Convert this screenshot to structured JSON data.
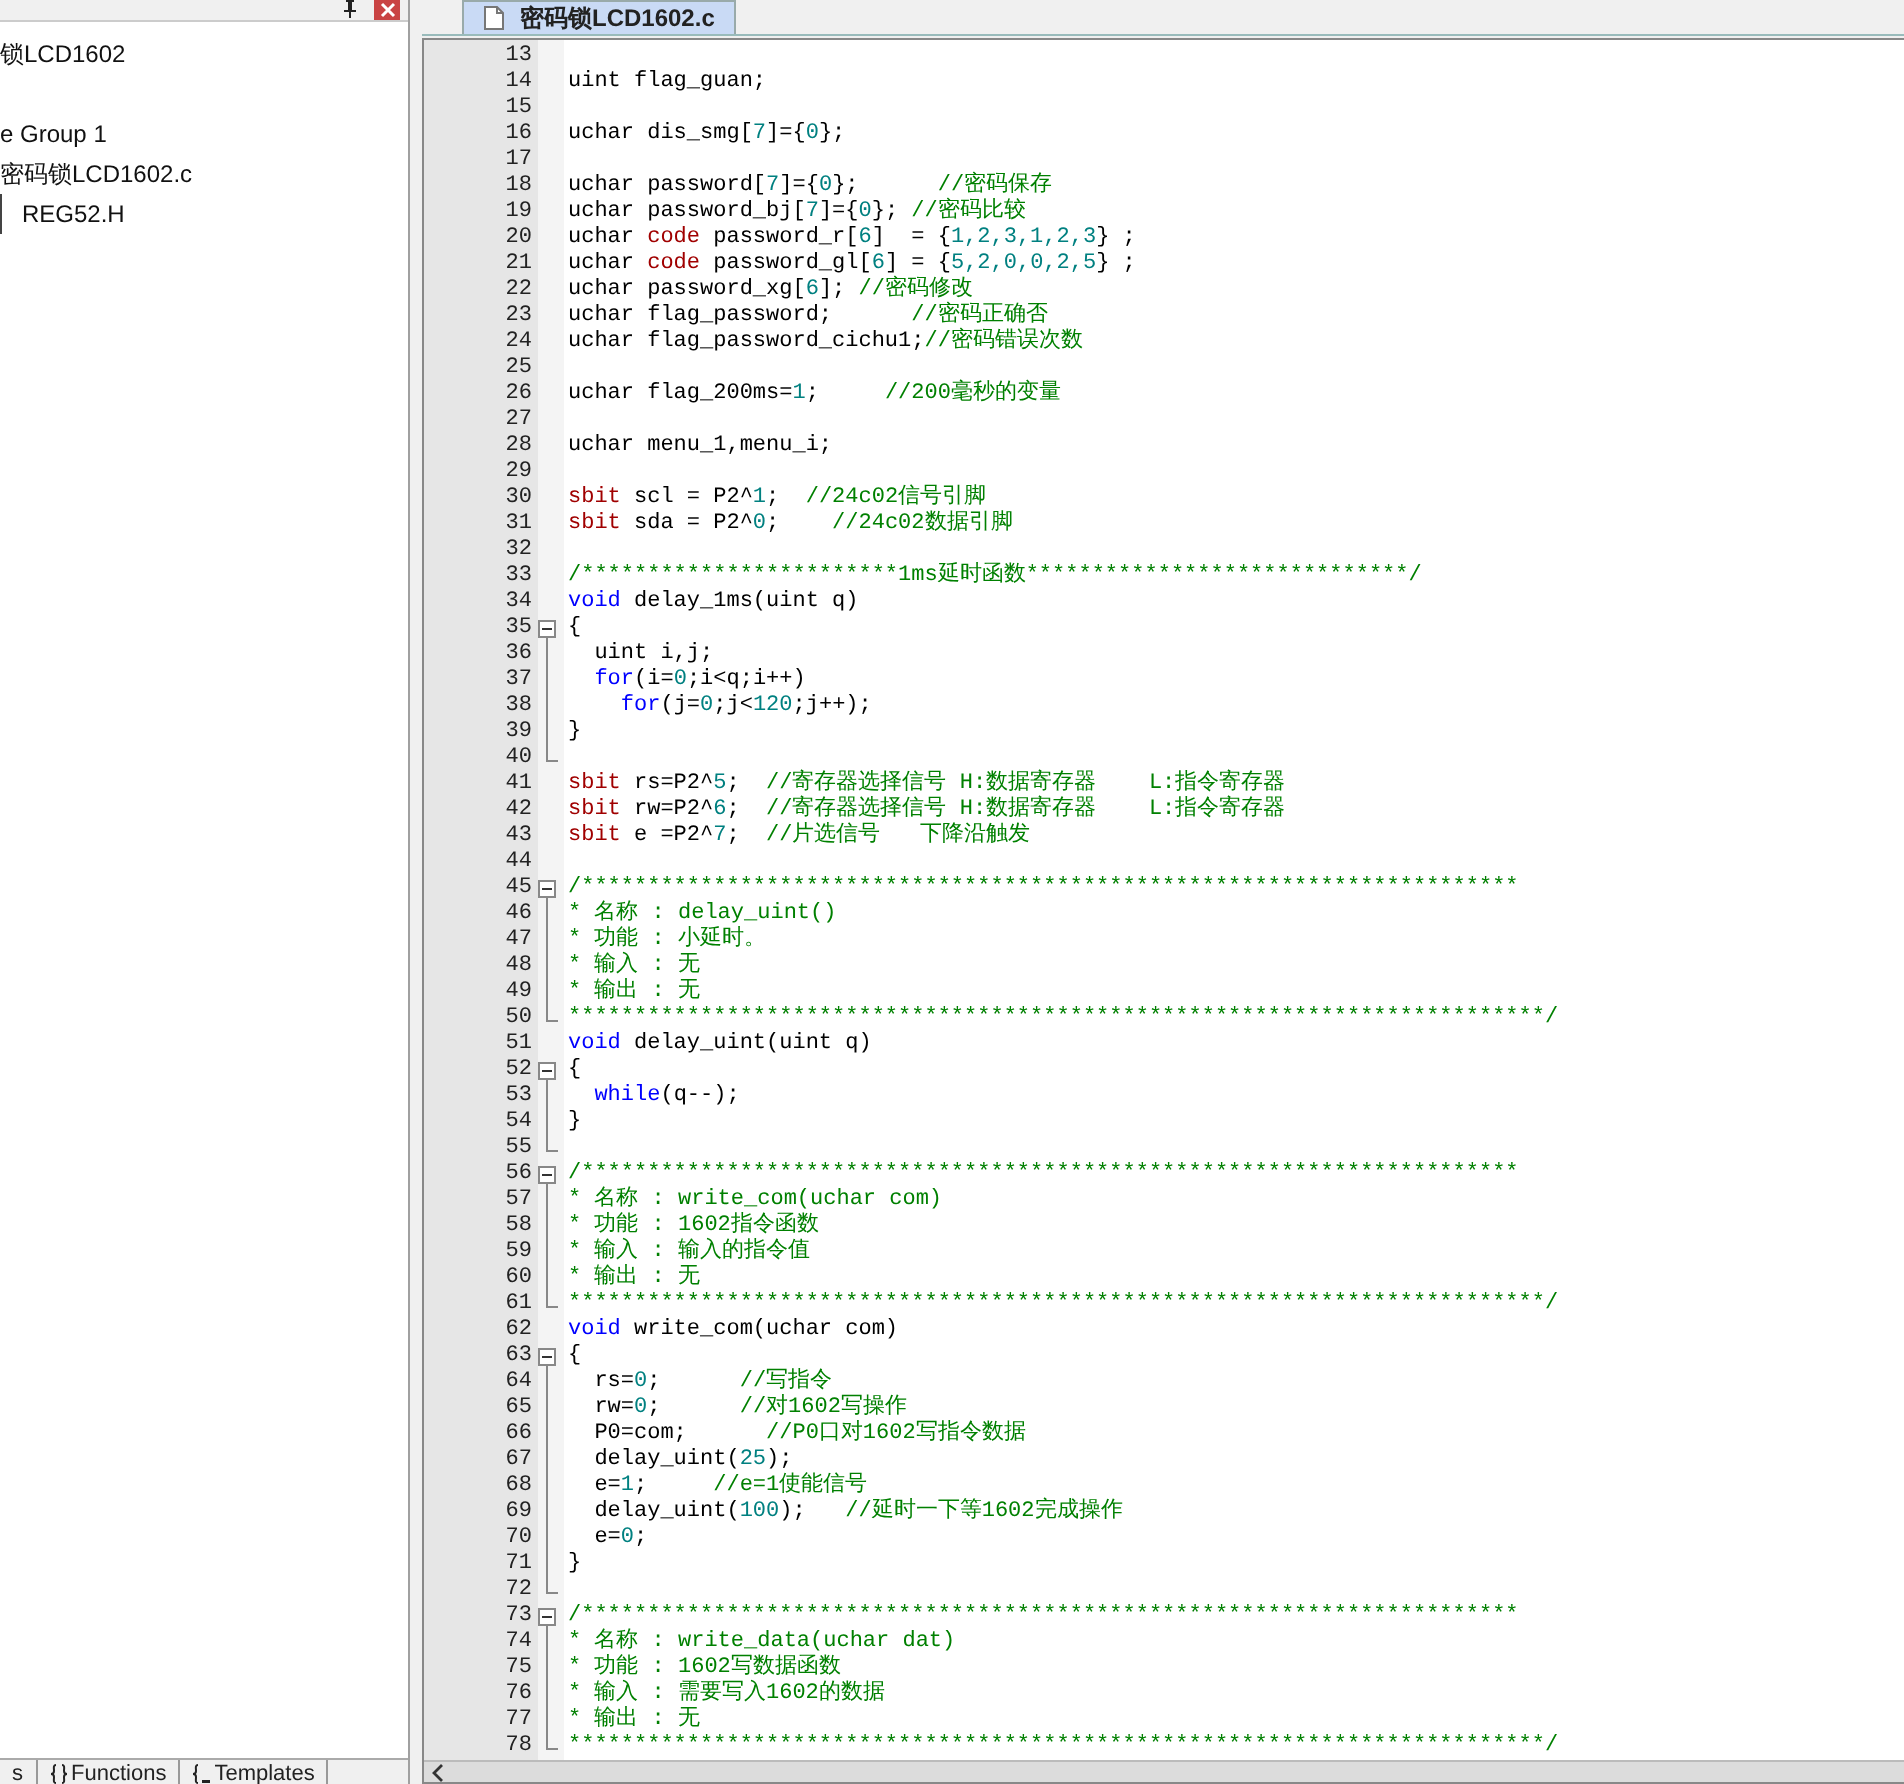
{
  "project_panel": {
    "tree": [
      {
        "label": "锁LCD1602",
        "children": [
          {
            "label": "e Group 1",
            "children": [
              {
                "label": "密码锁LCD1602.c",
                "children": [
                  {
                    "label": "REG52.H"
                  }
                ]
              }
            ]
          }
        ]
      }
    ],
    "tabs": [
      {
        "label": "s",
        "selected": false
      },
      {
        "label": "Functions",
        "selected": false
      },
      {
        "label": "Templates",
        "selected": false
      }
    ]
  },
  "editor": {
    "tabs": [
      {
        "label": "密码锁LCD1602.c",
        "selected": true
      }
    ],
    "lines": [
      {
        "number": "13",
        "kind": "code"
      },
      {
        "number": "14",
        "kind": "code",
        "segments": [
          {
            "kind": "plain",
            "text": "uint flag_guan;"
          }
        ]
      },
      {
        "number": "15",
        "kind": "code"
      },
      {
        "number": "16",
        "kind": "code",
        "segments": [
          {
            "kind": "plain",
            "text": "uchar dis_smg["
          },
          {
            "kind": "number",
            "text": "7"
          },
          {
            "kind": "plain",
            "text": "]={"
          },
          {
            "kind": "number",
            "text": "0"
          },
          {
            "kind": "plain",
            "text": "};"
          }
        ]
      },
      {
        "number": "17",
        "kind": "code"
      },
      {
        "number": "18",
        "kind": "code",
        "segments": [
          {
            "kind": "plain",
            "text": "uchar password["
          },
          {
            "kind": "number",
            "text": "7"
          },
          {
            "kind": "plain",
            "text": "]={"
          },
          {
            "kind": "number",
            "text": "0"
          },
          {
            "kind": "plain",
            "text": "};      "
          },
          {
            "kind": "comment",
            "text": "//密码保存"
          }
        ]
      },
      {
        "number": "19",
        "kind": "code",
        "segments": [
          {
            "kind": "plain",
            "text": "uchar password_bj["
          },
          {
            "kind": "number",
            "text": "7"
          },
          {
            "kind": "plain",
            "text": "]={"
          },
          {
            "kind": "number",
            "text": "0"
          },
          {
            "kind": "plain",
            "text": "}; "
          },
          {
            "kind": "comment",
            "text": "//密码比较"
          }
        ]
      },
      {
        "number": "20",
        "kind": "code",
        "segments": [
          {
            "kind": "plain",
            "text": "uchar "
          },
          {
            "kind": "storage",
            "text": "code"
          },
          {
            "kind": "plain",
            "text": " password_r["
          },
          {
            "kind": "number",
            "text": "6"
          },
          {
            "kind": "plain",
            "text": "]  = {"
          },
          {
            "kind": "number",
            "text": "1,2,3,1,2,3"
          },
          {
            "kind": "plain",
            "text": "} ;"
          }
        ]
      },
      {
        "number": "21",
        "kind": "code",
        "segments": [
          {
            "kind": "plain",
            "text": "uchar "
          },
          {
            "kind": "storage",
            "text": "code"
          },
          {
            "kind": "plain",
            "text": " password_gl["
          },
          {
            "kind": "number",
            "text": "6"
          },
          {
            "kind": "plain",
            "text": "] = {"
          },
          {
            "kind": "number",
            "text": "5,2,0,0,2,5"
          },
          {
            "kind": "plain",
            "text": "} ;"
          }
        ]
      },
      {
        "number": "22",
        "kind": "code",
        "segments": [
          {
            "kind": "plain",
            "text": "uchar password_xg["
          },
          {
            "kind": "number",
            "text": "6"
          },
          {
            "kind": "plain",
            "text": "]; "
          },
          {
            "kind": "comment",
            "text": "//密码修改"
          }
        ]
      },
      {
        "number": "23",
        "kind": "code",
        "segments": [
          {
            "kind": "plain",
            "text": "uchar flag_password;      "
          },
          {
            "kind": "comment",
            "text": "//密码正确否"
          }
        ]
      },
      {
        "number": "24",
        "kind": "code",
        "segments": [
          {
            "kind": "plain",
            "text": "uchar flag_password_cichu1;"
          },
          {
            "kind": "comment",
            "text": "//密码错误次数"
          }
        ]
      },
      {
        "number": "25",
        "kind": "code"
      },
      {
        "number": "26",
        "kind": "code",
        "segments": [
          {
            "kind": "plain",
            "text": "uchar flag_200ms="
          },
          {
            "kind": "number",
            "text": "1"
          },
          {
            "kind": "plain",
            "text": ";     "
          },
          {
            "kind": "comment",
            "text": "//200毫秒的变量"
          }
        ]
      },
      {
        "number": "27",
        "kind": "code"
      },
      {
        "number": "28",
        "kind": "code",
        "segments": [
          {
            "kind": "plain",
            "text": "uchar menu_1,menu_i;"
          }
        ]
      },
      {
        "number": "29",
        "kind": "code"
      },
      {
        "number": "30",
        "kind": "code",
        "segments": [
          {
            "kind": "storage",
            "text": "sbit"
          },
          {
            "kind": "plain",
            "text": " scl = P2^"
          },
          {
            "kind": "number",
            "text": "1"
          },
          {
            "kind": "plain",
            "text": ";  "
          },
          {
            "kind": "comment",
            "text": "//24c02信号引脚"
          }
        ]
      },
      {
        "number": "31",
        "kind": "code",
        "segments": [
          {
            "kind": "storage",
            "text": "sbit"
          },
          {
            "kind": "plain",
            "text": " sda = P2^"
          },
          {
            "kind": "number",
            "text": "0"
          },
          {
            "kind": "plain",
            "text": ";    "
          },
          {
            "kind": "comment",
            "text": "//24c02数据引脚"
          }
        ]
      },
      {
        "number": "32",
        "kind": "code"
      },
      {
        "number": "33",
        "kind": "code",
        "segments": [
          {
            "kind": "comment",
            "text": "/************************1ms延时函数*****************************/"
          }
        ]
      },
      {
        "number": "34",
        "kind": "code",
        "segments": [
          {
            "kind": "keyword",
            "text": "void"
          },
          {
            "kind": "plain",
            "text": " delay_1ms(uint q)"
          }
        ]
      },
      {
        "number": "35",
        "kind": "fold-start",
        "segments": [
          {
            "kind": "plain",
            "text": "{"
          }
        ]
      },
      {
        "number": "36",
        "kind": "fold-body",
        "segments": [
          {
            "kind": "plain",
            "text": "  uint i,j;"
          }
        ]
      },
      {
        "number": "37",
        "kind": "fold-body",
        "segments": [
          {
            "kind": "keyword",
            "text": "  for"
          },
          {
            "kind": "plain",
            "text": "(i="
          },
          {
            "kind": "number",
            "text": "0"
          },
          {
            "kind": "plain",
            "text": ";i<q;i++)"
          }
        ]
      },
      {
        "number": "38",
        "kind": "fold-body",
        "segments": [
          {
            "kind": "keyword",
            "text": "    for"
          },
          {
            "kind": "plain",
            "text": "(j="
          },
          {
            "kind": "number",
            "text": "0"
          },
          {
            "kind": "plain",
            "text": ";j<"
          },
          {
            "kind": "number",
            "text": "120"
          },
          {
            "kind": "plain",
            "text": ";j++);"
          }
        ]
      },
      {
        "number": "39",
        "kind": "fold-body",
        "segments": [
          {
            "kind": "plain",
            "text": "}"
          }
        ]
      },
      {
        "number": "40",
        "kind": "fold-end"
      },
      {
        "number": "41",
        "kind": "code",
        "segments": [
          {
            "kind": "storage",
            "text": "sbit"
          },
          {
            "kind": "plain",
            "text": " rs=P2^"
          },
          {
            "kind": "number",
            "text": "5"
          },
          {
            "kind": "plain",
            "text": ";  "
          },
          {
            "kind": "comment",
            "text": "//寄存器选择信号 H:数据寄存器    L:指令寄存器"
          }
        ]
      },
      {
        "number": "42",
        "kind": "code",
        "segments": [
          {
            "kind": "storage",
            "text": "sbit"
          },
          {
            "kind": "plain",
            "text": " rw=P2^"
          },
          {
            "kind": "number",
            "text": "6"
          },
          {
            "kind": "plain",
            "text": ";  "
          },
          {
            "kind": "comment",
            "text": "//寄存器选择信号 H:数据寄存器    L:指令寄存器"
          }
        ]
      },
      {
        "number": "43",
        "kind": "code",
        "segments": [
          {
            "kind": "storage",
            "text": "sbit"
          },
          {
            "kind": "plain",
            "text": " e =P2^"
          },
          {
            "kind": "number",
            "text": "7"
          },
          {
            "kind": "plain",
            "text": ";  "
          },
          {
            "kind": "comment",
            "text": "//片选信号   下降沿触发"
          }
        ]
      },
      {
        "number": "44",
        "kind": "code"
      },
      {
        "number": "45",
        "kind": "fold-start",
        "segments": [
          {
            "kind": "comment",
            "text": "/***********************************************************************"
          }
        ]
      },
      {
        "number": "46",
        "kind": "fold-body",
        "segments": [
          {
            "kind": "comment",
            "text": "* 名称 : delay_uint()"
          }
        ]
      },
      {
        "number": "47",
        "kind": "fold-body",
        "segments": [
          {
            "kind": "comment",
            "text": "* 功能 : 小延时。"
          }
        ]
      },
      {
        "number": "48",
        "kind": "fold-body",
        "segments": [
          {
            "kind": "comment",
            "text": "* 输入 : 无"
          }
        ]
      },
      {
        "number": "49",
        "kind": "fold-body",
        "segments": [
          {
            "kind": "comment",
            "text": "* 输出 : 无"
          }
        ]
      },
      {
        "number": "50",
        "kind": "fold-end",
        "segments": [
          {
            "kind": "comment",
            "text": "**************************************************************************/"
          }
        ]
      },
      {
        "number": "51",
        "kind": "code",
        "segments": [
          {
            "kind": "keyword",
            "text": "void"
          },
          {
            "kind": "plain",
            "text": " delay_uint(uint q)"
          }
        ]
      },
      {
        "number": "52",
        "kind": "fold-start",
        "segments": [
          {
            "kind": "plain",
            "text": "{"
          }
        ]
      },
      {
        "number": "53",
        "kind": "fold-body",
        "segments": [
          {
            "kind": "keyword",
            "text": "  while"
          },
          {
            "kind": "plain",
            "text": "(q--);"
          }
        ]
      },
      {
        "number": "54",
        "kind": "fold-body",
        "segments": [
          {
            "kind": "plain",
            "text": "}"
          }
        ]
      },
      {
        "number": "55",
        "kind": "fold-end"
      },
      {
        "number": "56",
        "kind": "fold-start",
        "segments": [
          {
            "kind": "comment",
            "text": "/***********************************************************************"
          }
        ]
      },
      {
        "number": "57",
        "kind": "fold-body",
        "segments": [
          {
            "kind": "comment",
            "text": "* 名称 : write_com(uchar com)"
          }
        ]
      },
      {
        "number": "58",
        "kind": "fold-body",
        "segments": [
          {
            "kind": "comment",
            "text": "* 功能 : 1602指令函数"
          }
        ]
      },
      {
        "number": "59",
        "kind": "fold-body",
        "segments": [
          {
            "kind": "comment",
            "text": "* 输入 : 输入的指令值"
          }
        ]
      },
      {
        "number": "60",
        "kind": "fold-body",
        "segments": [
          {
            "kind": "comment",
            "text": "* 输出 : 无"
          }
        ]
      },
      {
        "number": "61",
        "kind": "fold-end",
        "segments": [
          {
            "kind": "comment",
            "text": "**************************************************************************/"
          }
        ]
      },
      {
        "number": "62",
        "kind": "code",
        "segments": [
          {
            "kind": "keyword",
            "text": "void"
          },
          {
            "kind": "plain",
            "text": " write_com(uchar com)"
          }
        ]
      },
      {
        "number": "63",
        "kind": "fold-start",
        "segments": [
          {
            "kind": "plain",
            "text": "{"
          }
        ]
      },
      {
        "number": "64",
        "kind": "fold-body",
        "segments": [
          {
            "kind": "plain",
            "text": "  rs="
          },
          {
            "kind": "number",
            "text": "0"
          },
          {
            "kind": "plain",
            "text": ";      "
          },
          {
            "kind": "comment",
            "text": "//写指令"
          }
        ]
      },
      {
        "number": "65",
        "kind": "fold-body",
        "segments": [
          {
            "kind": "plain",
            "text": "  rw="
          },
          {
            "kind": "number",
            "text": "0"
          },
          {
            "kind": "plain",
            "text": ";      "
          },
          {
            "kind": "comment",
            "text": "//对1602写操作"
          }
        ]
      },
      {
        "number": "66",
        "kind": "fold-body",
        "segments": [
          {
            "kind": "plain",
            "text": "  P0=com;      "
          },
          {
            "kind": "comment",
            "text": "//P0口对1602写指令数据"
          }
        ]
      },
      {
        "number": "67",
        "kind": "fold-body",
        "segments": [
          {
            "kind": "plain",
            "text": "  delay_uint("
          },
          {
            "kind": "number",
            "text": "25"
          },
          {
            "kind": "plain",
            "text": ");"
          }
        ]
      },
      {
        "number": "68",
        "kind": "fold-body",
        "segments": [
          {
            "kind": "plain",
            "text": "  e="
          },
          {
            "kind": "number",
            "text": "1"
          },
          {
            "kind": "plain",
            "text": ";     "
          },
          {
            "kind": "comment",
            "text": "//e=1使能信号"
          }
        ]
      },
      {
        "number": "69",
        "kind": "fold-body",
        "segments": [
          {
            "kind": "plain",
            "text": "  delay_uint("
          },
          {
            "kind": "number",
            "text": "100"
          },
          {
            "kind": "plain",
            "text": ");   "
          },
          {
            "kind": "comment",
            "text": "//延时一下等1602完成操作"
          }
        ]
      },
      {
        "number": "70",
        "kind": "fold-body",
        "segments": [
          {
            "kind": "plain",
            "text": "  e="
          },
          {
            "kind": "number",
            "text": "0"
          },
          {
            "kind": "plain",
            "text": ";"
          }
        ]
      },
      {
        "number": "71",
        "kind": "fold-body",
        "segments": [
          {
            "kind": "plain",
            "text": "}"
          }
        ]
      },
      {
        "number": "72",
        "kind": "fold-end"
      },
      {
        "number": "73",
        "kind": "fold-start",
        "segments": [
          {
            "kind": "comment",
            "text": "/***********************************************************************"
          }
        ]
      },
      {
        "number": "74",
        "kind": "fold-body",
        "segments": [
          {
            "kind": "comment",
            "text": "* 名称 : write_data(uchar dat)"
          }
        ]
      },
      {
        "number": "75",
        "kind": "fold-body",
        "segments": [
          {
            "kind": "comment",
            "text": "* 功能 : 1602写数据函数"
          }
        ]
      },
      {
        "number": "76",
        "kind": "fold-body",
        "segments": [
          {
            "kind": "comment",
            "text": "* 输入 : 需要写入1602的数据"
          }
        ]
      },
      {
        "number": "77",
        "kind": "fold-body",
        "segments": [
          {
            "kind": "comment",
            "text": "* 输出 : 无"
          }
        ]
      },
      {
        "number": "78",
        "kind": "fold-end",
        "segments": [
          {
            "kind": "comment",
            "text": "**************************************************************************/"
          }
        ]
      }
    ]
  }
}
